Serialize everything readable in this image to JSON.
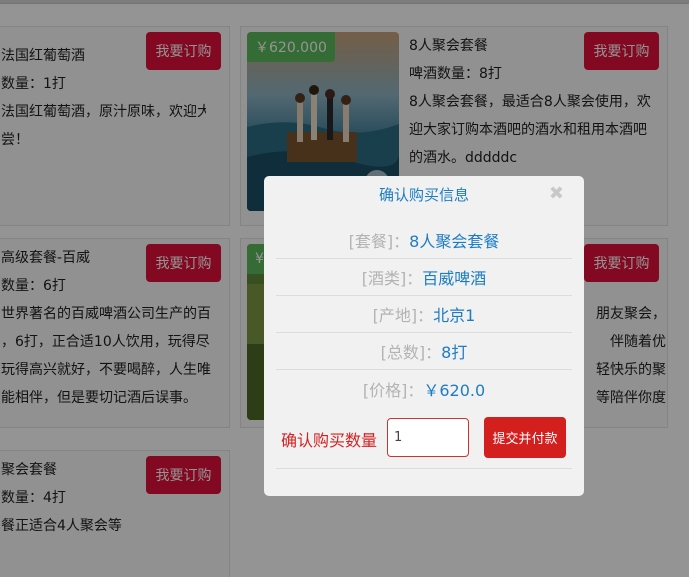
{
  "products": [
    {
      "title": "法国红葡萄酒",
      "qty_line": "数量：1打",
      "desc_lines": [
        "法国红葡萄酒，原汁原味，欢迎大",
        "尝！"
      ],
      "order_label": "我要订购"
    },
    {
      "price": "￥620.000",
      "title": "8人聚会套餐",
      "qty_line": "啤酒数量：8打",
      "desc_lines": [
        "8人聚会套餐，最适合8人聚会使用，欢",
        "迎大家订购本酒吧的酒水和租用本酒吧",
        "的酒水。dddddc"
      ],
      "order_label": "我要订购"
    },
    {
      "title": "高级套餐-百威",
      "qty_line": "数量：6打",
      "desc_lines": [
        "世界著名的百威啤酒公司生产的百",
        "，6打，正合适10人饮用，玩得尽",
        "玩得高兴就好，不要喝醉，人生唯",
        "能相伴，但是要切记酒后误事。"
      ],
      "order_label": "我要订购"
    },
    {
      "price": "¥",
      "desc_lines": [
        "朋友聚会，",
        "伴随着优",
        "轻快乐的聚",
        "等陪伴你度"
      ],
      "order_label": "我要订购"
    },
    {
      "title": "聚会套餐",
      "qty_line": "数量：4打",
      "desc_lines": [
        "餐正适合4人聚会等"
      ],
      "order_label": "我要订购"
    }
  ],
  "modal": {
    "title": "确认购买信息",
    "close_symbol": "✖",
    "rows": [
      {
        "label": "[套餐]：",
        "value": "8人聚会套餐"
      },
      {
        "label": "[酒类]：",
        "value": "百威啤酒"
      },
      {
        "label": "[产地]：",
        "value": "北京1"
      },
      {
        "label": "[总数]：",
        "value": "8打"
      },
      {
        "label": "[价格]：",
        "value": "￥620.0"
      }
    ],
    "quantity_label": "确认购买数量",
    "quantity_value": "1",
    "submit_label": "提交并付款"
  },
  "colors": {
    "accent": "#1d7dc4",
    "order_button": "#e0103a",
    "submit_button": "#d41f1f",
    "price_badge": "#5cb85c"
  },
  "icons": {
    "close": "close-icon"
  }
}
